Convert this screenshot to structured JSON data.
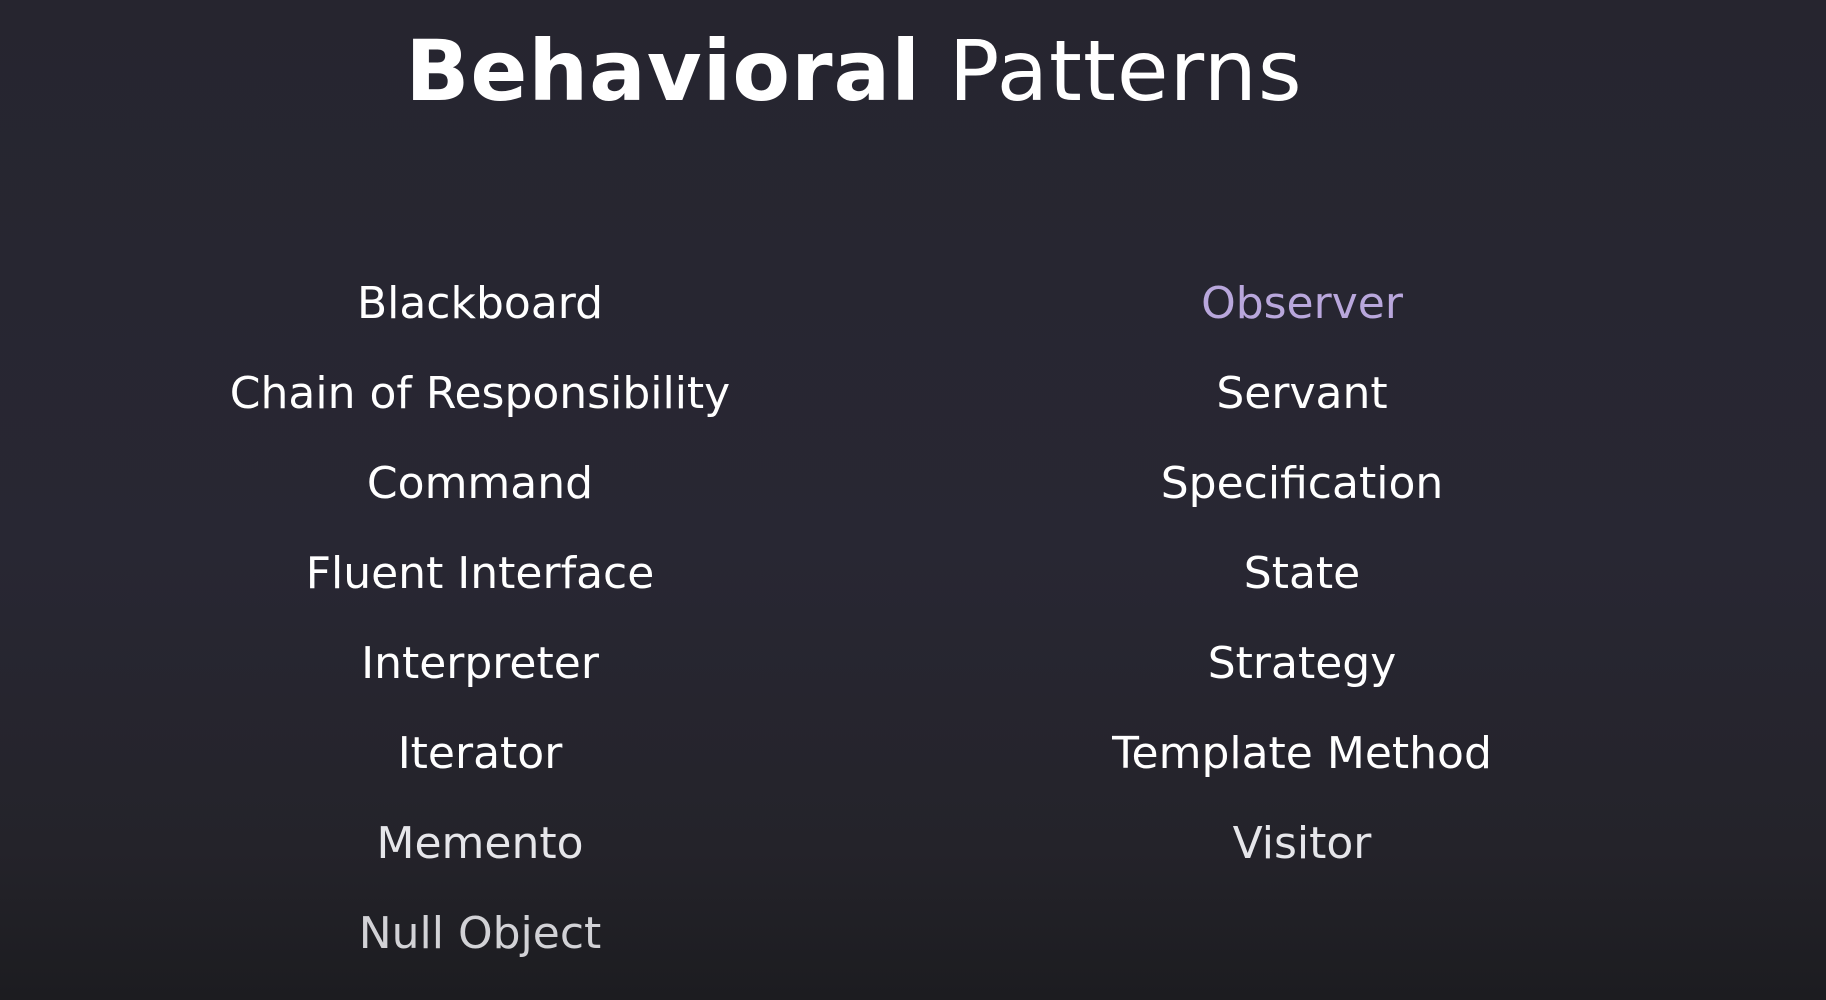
{
  "slide": {
    "title_bold": "Behavioral",
    "title_light": "Patterns",
    "left_column": [
      "Blackboard",
      "Chain of Responsibility",
      "Command",
      "Fluent Interface",
      "Interpreter",
      "Iterator",
      "Memento",
      "Null Object"
    ],
    "right_column": [
      "Observer",
      "Servant",
      "Specification",
      "State",
      "Strategy",
      "Template Method",
      "Visitor"
    ],
    "highlighted_item": "Observer",
    "colors": {
      "background": "#282733",
      "text": "#ffffff",
      "highlight": "#b9a7dc"
    }
  }
}
